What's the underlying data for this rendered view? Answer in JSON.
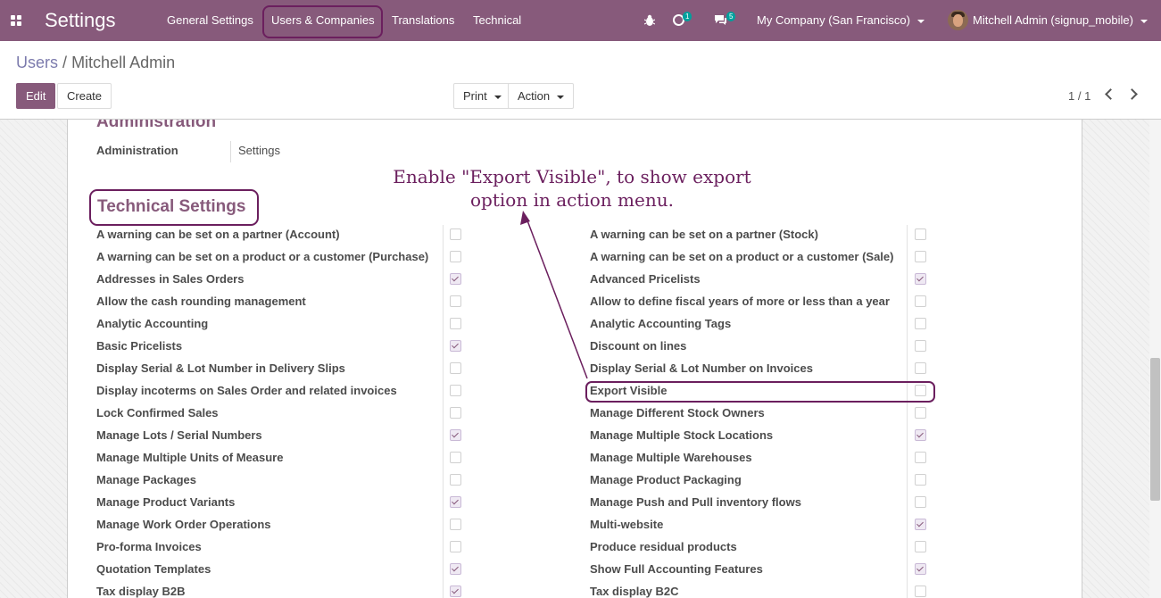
{
  "navbar": {
    "app_title": "Settings",
    "menu": [
      "General Settings",
      "Users & Companies",
      "Translations",
      "Technical"
    ],
    "activity_badge": "1",
    "messages_badge": "5",
    "company": "My Company (San Francisco)",
    "user": "Mitchell Admin (signup_mobile)",
    "colors": {
      "bar": "#875a7b",
      "badge": "#00a09d",
      "highlight": "#6b1f5e"
    }
  },
  "breadcrumb": {
    "parent": "Users",
    "separator": "/",
    "current": "Mitchell Admin"
  },
  "buttons": {
    "edit": "Edit",
    "create": "Create",
    "print": "Print",
    "action": "Action"
  },
  "pager": {
    "value": "1 / 1"
  },
  "administration": {
    "title": "Administration",
    "label": "Administration",
    "value": "Settings"
  },
  "technical": {
    "title": "Technical Settings",
    "hint": "Enable \"Export Visible\", to show export option in action menu.",
    "left": [
      {
        "label": "A warning can be set on a partner (Account)",
        "checked": false
      },
      {
        "label": "A warning can be set on a product or a customer (Purchase)",
        "checked": false
      },
      {
        "label": "Addresses in Sales Orders",
        "checked": true
      },
      {
        "label": "Allow the cash rounding management",
        "checked": false
      },
      {
        "label": "Analytic Accounting",
        "checked": false
      },
      {
        "label": "Basic Pricelists",
        "checked": true
      },
      {
        "label": "Display Serial & Lot Number in Delivery Slips",
        "checked": false
      },
      {
        "label": "Display incoterms on Sales Order and related invoices",
        "checked": false
      },
      {
        "label": "Lock Confirmed Sales",
        "checked": false
      },
      {
        "label": "Manage Lots / Serial Numbers",
        "checked": true
      },
      {
        "label": "Manage Multiple Units of Measure",
        "checked": false
      },
      {
        "label": "Manage Packages",
        "checked": false
      },
      {
        "label": "Manage Product Variants",
        "checked": true
      },
      {
        "label": "Manage Work Order Operations",
        "checked": false
      },
      {
        "label": "Pro-forma Invoices",
        "checked": false
      },
      {
        "label": "Quotation Templates",
        "checked": true
      },
      {
        "label": "Tax display B2B",
        "checked": true
      }
    ],
    "right": [
      {
        "label": "A warning can be set on a partner (Stock)",
        "checked": false
      },
      {
        "label": "A warning can be set on a product or a customer (Sale)",
        "checked": false
      },
      {
        "label": "Advanced Pricelists",
        "checked": true
      },
      {
        "label": "Allow to define fiscal years of more or less than a year",
        "checked": false
      },
      {
        "label": "Analytic Accounting Tags",
        "checked": false
      },
      {
        "label": "Discount on lines",
        "checked": false
      },
      {
        "label": "Display Serial & Lot Number on Invoices",
        "checked": false
      },
      {
        "label": "Export Visible",
        "checked": false
      },
      {
        "label": "Manage Different Stock Owners",
        "checked": false
      },
      {
        "label": "Manage Multiple Stock Locations",
        "checked": true
      },
      {
        "label": "Manage Multiple Warehouses",
        "checked": false
      },
      {
        "label": "Manage Product Packaging",
        "checked": false
      },
      {
        "label": "Manage Push and Pull inventory flows",
        "checked": false
      },
      {
        "label": "Multi-website",
        "checked": true
      },
      {
        "label": "Produce residual products",
        "checked": false
      },
      {
        "label": "Show Full Accounting Features",
        "checked": true
      },
      {
        "label": "Tax display B2C",
        "checked": false
      }
    ]
  }
}
